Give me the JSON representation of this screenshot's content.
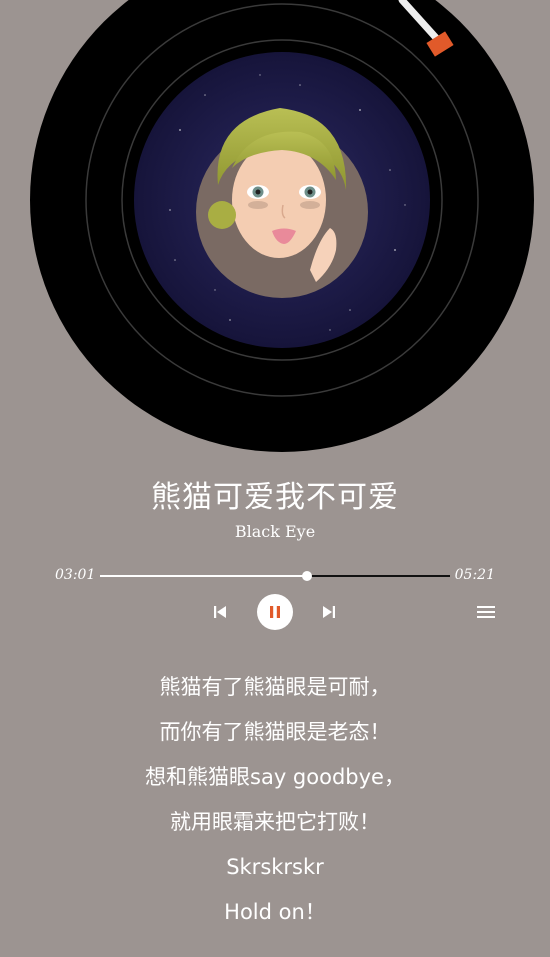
{
  "player": {
    "song_title": "熊猫可爱我不可爱",
    "artist": "Black Eye",
    "elapsed": "03:01",
    "duration": "05:21",
    "progress": 0.59
  },
  "controls": {
    "prev_icon": "skip-previous-icon",
    "play_state_icon": "pause-icon",
    "next_icon": "skip-next-icon",
    "menu_icon": "playlist-menu-icon",
    "accent_color": "#e15a2a"
  },
  "lyrics": [
    "熊猫有了熊猫眼是可耐，",
    "而你有了熊猫眼是老态！",
    "想和熊猫眼say goodbye，",
    "就用眼霜来把它打败！",
    "Skrskrskr",
    "Hold on！"
  ],
  "colors": {
    "background": "#9c9491",
    "record": "#000000",
    "label_space": "#1c1a48"
  }
}
